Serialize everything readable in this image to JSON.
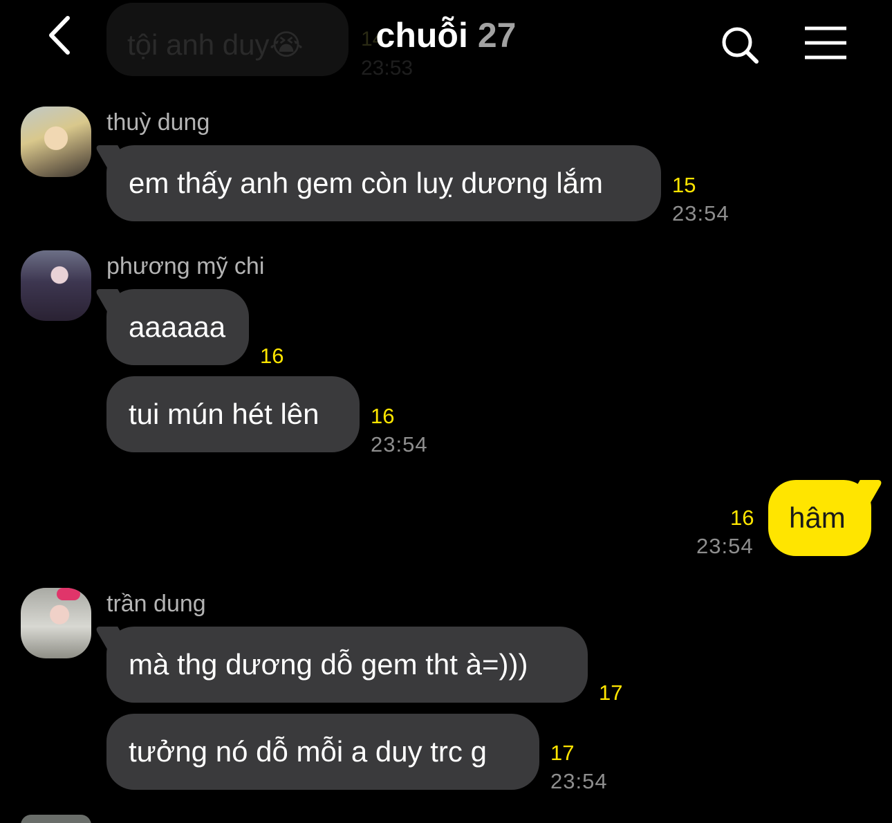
{
  "header": {
    "title": "chuỗi",
    "member_count": "27",
    "icons": {
      "back": "chevron-left-icon",
      "search": "search-icon",
      "menu": "hamburger-menu-icon"
    }
  },
  "ghost_message": {
    "text": "tội anh duy😭",
    "count": "14",
    "time": "23:53"
  },
  "messages": [
    {
      "sender": "thuỳ dung",
      "bubbles": [
        {
          "text": "em thấy anh gem còn luỵ dương lắm",
          "count": "15",
          "time": "23:54"
        }
      ]
    },
    {
      "sender": "phương mỹ chi",
      "bubbles": [
        {
          "text": "aaaaaa",
          "count": "16",
          "time": ""
        },
        {
          "text": "tui mún hét lên",
          "count": "16",
          "time": "23:54"
        }
      ]
    },
    {
      "mine": true,
      "bubbles": [
        {
          "text": "hâm",
          "count": "16",
          "time": "23:54"
        }
      ]
    },
    {
      "sender": "trần dung",
      "bubbles": [
        {
          "text": "mà thg dương dỗ gem tht à=)))",
          "count": "17",
          "time": ""
        },
        {
          "text": "tưởng nó dỗ mỗi a duy trc g",
          "count": "17",
          "time": "23:54"
        }
      ]
    }
  ],
  "colors": {
    "background": "#000000",
    "incoming_bubble": "#3a3a3c",
    "outgoing_bubble": "#ffe500",
    "unread_count": "#ffe500",
    "timestamp": "#8e8e8e",
    "sender_name": "#b4b4b4"
  }
}
